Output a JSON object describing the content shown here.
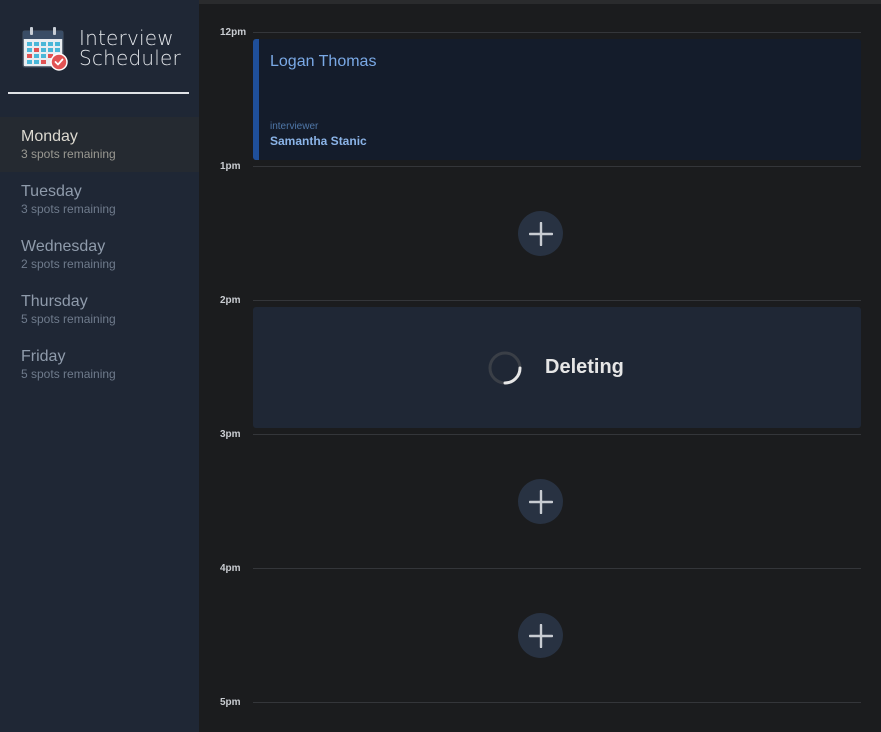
{
  "brand": {
    "line1": "Interview",
    "line2": "Scheduler"
  },
  "days": [
    {
      "name": "Monday",
      "spots": "3 spots remaining",
      "selected": true
    },
    {
      "name": "Tuesday",
      "spots": "3 spots remaining",
      "selected": false
    },
    {
      "name": "Wednesday",
      "spots": "2 spots remaining",
      "selected": false
    },
    {
      "name": "Thursday",
      "spots": "5 spots remaining",
      "selected": false
    },
    {
      "name": "Friday",
      "spots": "5 spots remaining",
      "selected": false
    }
  ],
  "schedule": {
    "times": [
      "12pm",
      "1pm",
      "2pm",
      "3pm",
      "4pm",
      "5pm"
    ],
    "appointment": {
      "student": "Logan Thomas",
      "interviewer_label": "interviewer",
      "interviewer": "Samantha Stanic"
    },
    "status": {
      "message": "Deleting"
    },
    "add_icon": "plus-icon",
    "spinner_icon": "spinner-icon"
  },
  "colors": {
    "sidebar_bg": "#1f2735",
    "page_bg": "#1b1c1e",
    "accent_blue": "#7aa9e6",
    "card_bg": "#141c2b"
  }
}
